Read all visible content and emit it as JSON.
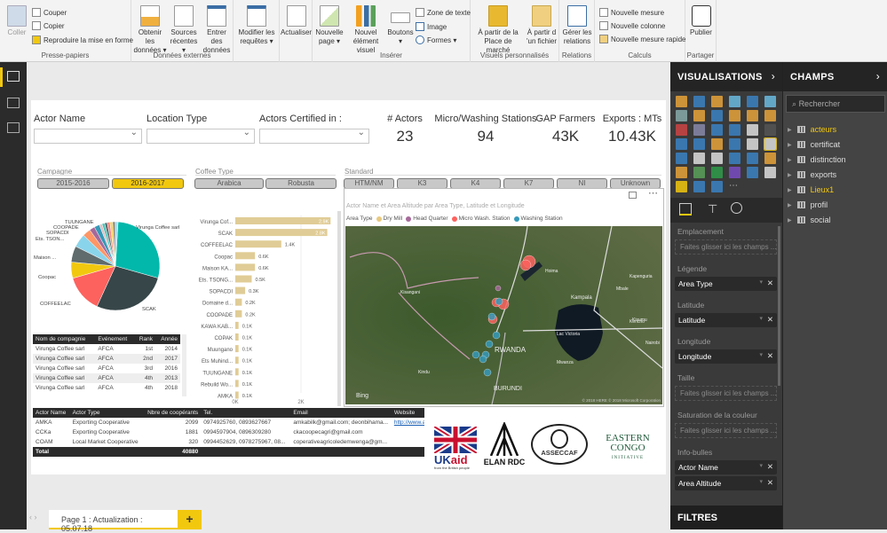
{
  "ribbon": {
    "clipboard": {
      "paste": "Coller",
      "cut": "Couper",
      "copy": "Copier",
      "format_painter": "Reproduire la mise en forme",
      "group": "Presse-papiers"
    },
    "external": {
      "get_data": "Obtenir les données ▾",
      "recent": "Sources récentes ▾",
      "enter": "Entrer des données",
      "group": "Données externes"
    },
    "edit_queries": "Modifier les requêtes ▾",
    "refresh": "Actualiser",
    "insert": {
      "new_page": "Nouvelle page ▾",
      "new_visual": "Nouvel élément visuel",
      "buttons": "Boutons ▾",
      "textbox": "Zone de texte",
      "image": "Image",
      "shapes": "Formes ▾",
      "group": "Insérer"
    },
    "custom": {
      "marketplace": "À partir de la Place de marché",
      "file": "À partir d 'un fichier",
      "group": "Visuels personnalisés"
    },
    "relations": {
      "manage": "Gérer les relations",
      "group": "Relations"
    },
    "calc": {
      "measure": "Nouvelle mesure",
      "column": "Nouvelle colonne",
      "quick": "Nouvelle mesure rapide",
      "group": "Calculs"
    },
    "share": {
      "publish": "Publier",
      "group": "Partager"
    }
  },
  "slicers": {
    "actor_name": "Actor Name",
    "location_type": "Location Type",
    "certified": "Actors Certified in :"
  },
  "cards": [
    {
      "title": "# Actors",
      "value": "23"
    },
    {
      "title": "Micro/Washing Stations",
      "value": "94"
    },
    {
      "title": "GAP Farmers",
      "value": "43K"
    },
    {
      "title": "Exports : MTs",
      "value": "10.43K"
    }
  ],
  "campagne": {
    "title": "Campagne",
    "options": [
      "2015-2016",
      "2016-2017"
    ],
    "selected": "2016-2017"
  },
  "coffee_type": {
    "title": "Coffee Type",
    "options": [
      "Arabica",
      "Robusta"
    ]
  },
  "standard": {
    "title": "Standard",
    "options": [
      "HTM/NM",
      "K3",
      "K4",
      "K7",
      "NI",
      "Unknown"
    ]
  },
  "accent": "#f2c80f",
  "chart_data": [
    {
      "type": "pie",
      "labels": [
        "Virunga Coffee sarl",
        "SCAK",
        "COFFEELAC",
        "Coopac",
        "Maison ...",
        "Ets. TSON...",
        "SOPACDI",
        "Domaine d...",
        "COOPADE",
        "KAWA KAB...",
        "COPAK",
        "Muungano",
        "Ets Muhind...",
        "TUUNGANE",
        "Rebuild Wo...",
        "AMKA"
      ],
      "values": [
        2900,
        2800,
        1400,
        600,
        600,
        500,
        300,
        200,
        200,
        100,
        100,
        100,
        100,
        100,
        100,
        100
      ],
      "shown_labels": [
        "Virunga Coffee sarl",
        "SCAK",
        "COFFEELAC",
        "Coopac",
        "Maison ...",
        "Ets. TSON...",
        "SOPACDI",
        "COOPADE",
        "TUUNGANE"
      ],
      "colors": [
        "#01b8aa",
        "#374649",
        "#fd625e",
        "#f2c80f",
        "#5f6b6d",
        "#8ad4eb",
        "#fe9666",
        "#a66999",
        "#3599b8",
        "#dfbfbf",
        "#4ac5bb",
        "#5f6b6d",
        "#fb8281",
        "#f4d25a",
        "#7f898a",
        "#a4ddee"
      ]
    },
    {
      "type": "bar",
      "orientation": "horizontal",
      "categories": [
        "Virunga Cof...",
        "SCAK",
        "COFFEELAC",
        "Coopac",
        "Maison KA...",
        "Ets. TSONG...",
        "SOPACDI",
        "Domaine d...",
        "COOPADE",
        "KAWA KAB...",
        "COPAK",
        "Muungano",
        "Ets Muhind...",
        "TUUNGANE",
        "Rebuild Wo...",
        "AMKA"
      ],
      "values": [
        2900,
        2800,
        1400,
        600,
        600,
        500,
        300,
        200,
        200,
        100,
        100,
        100,
        100,
        100,
        100,
        100
      ],
      "data_labels": [
        "2.9K",
        "2.8K",
        "1.4K",
        "0.6K",
        "0.6K",
        "0.5K",
        "0.3K",
        "0.2K",
        "0.2K",
        "0.1K",
        "0.1K",
        "0.1K",
        "0.1K",
        "0.1K",
        "0.1K",
        "0.1K"
      ],
      "x_ticks": [
        "0K",
        "2K"
      ],
      "xlim": [
        0,
        3000
      ],
      "color": "#e0cc96"
    }
  ],
  "distinctions": {
    "headers": [
      "Nom de compagnie",
      "Evénement",
      "Rank",
      "Année"
    ],
    "rows": [
      [
        "Virunga Coffee sarl",
        "AFCA",
        "1st",
        "2014"
      ],
      [
        "Virunga Coffee sarl",
        "AFCA",
        "2nd",
        "2017"
      ],
      [
        "Virunga Coffee sarl",
        "AFCA",
        "3rd",
        "2016"
      ],
      [
        "Virunga Coffee sarl",
        "AFCA",
        "4th",
        "2013"
      ],
      [
        "Virunga Coffee sarl",
        "AFCA",
        "4th",
        "2018"
      ]
    ]
  },
  "map": {
    "title": "Actor Name et Area Altitude par Area Type, Latitude et Longitude",
    "legend_title": "Area Type",
    "legend": [
      {
        "label": "Dry Mill",
        "color": "#e8c97e"
      },
      {
        "label": "Head Quarter",
        "color": "#a66999"
      },
      {
        "label": "Micro Wash. Station",
        "color": "#fd625e"
      },
      {
        "label": "Washing Station",
        "color": "#3599b8"
      }
    ],
    "places": [
      "RWANDA",
      "BURUNDI",
      "Kampala",
      "Lac Victoria",
      "Kisangani",
      "Kindu",
      "Mwanza",
      "Nairobi",
      "Kisumu",
      "Kericho",
      "Hoima",
      "Mbale",
      "Kapenguria",
      "Bing"
    ],
    "copyright": "© 2018 HERE © 2018 Microsoft Corporation"
  },
  "actors": {
    "headers": [
      "Actor Name",
      "Actor Type",
      "Nbre de coopérants",
      "Tel.",
      "Email",
      "Website"
    ],
    "rows": [
      [
        "AMKA",
        "Exporting Cooperative",
        "2099",
        "0974925760, 0893627667",
        "amkabilk@gmail.com; deonbihama...",
        "http://www.a..."
      ],
      [
        "CCKa",
        "Exporting Cooperative",
        "1881",
        "0994597904, 0896309280",
        "ckacoopecagri@gmail.com",
        ""
      ],
      [
        "COAM",
        "Local Market Cooperative",
        "320",
        "0994452629, 0978275967, 08...",
        "coperativeagricoledemwenga@gm...",
        ""
      ]
    ],
    "total_label": "Total",
    "total": "40880"
  },
  "logos": [
    "UKaid",
    "from the British people",
    "ELAN RDC",
    "ASSECCAF",
    "EASTERN CONGO INITIATIVE"
  ],
  "pages": {
    "tab": "Page 1 : Actualization : 05.07.18",
    "add": "+"
  },
  "viz": {
    "title": "VISUALISATIONS",
    "wells": [
      {
        "label": "Emplacement",
        "fields": []
      },
      {
        "label": "Légende",
        "fields": [
          "Area Type"
        ]
      },
      {
        "label": "Latitude",
        "fields": [
          "Latitude"
        ]
      },
      {
        "label": "Longitude",
        "fields": [
          "Longitude"
        ]
      },
      {
        "label": "Taille",
        "fields": []
      },
      {
        "label": "Saturation de la couleur",
        "fields": []
      },
      {
        "label": "Info-bulles",
        "fields": [
          "Actor Name",
          "Area Altitude"
        ]
      }
    ],
    "placeholder": "Faites glisser ici les champs ...",
    "filters": "FILTRES"
  },
  "fields": {
    "title": "CHAMPS",
    "search": "Rechercher",
    "tables": [
      {
        "name": "acteurs",
        "active": true
      },
      {
        "name": "certificat"
      },
      {
        "name": "distinction"
      },
      {
        "name": "exports"
      },
      {
        "name": "Lieux1",
        "active": true
      },
      {
        "name": "profil"
      },
      {
        "name": "social"
      }
    ]
  }
}
